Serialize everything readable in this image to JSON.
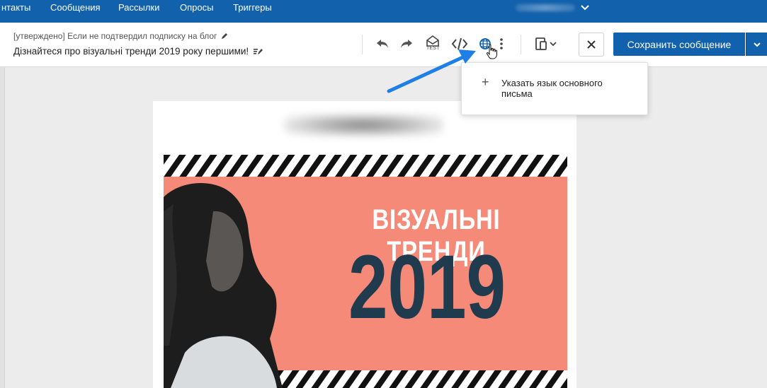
{
  "nav": {
    "items": [
      "нтакты",
      "Сообщения",
      "Рассылки",
      "Опросы",
      "Триггеры"
    ]
  },
  "header": {
    "subject": "[утверждено] Если не подтвердил подписку на блог",
    "preheader": "Дізнайтеся про візуальні тренди 2019 року першими!"
  },
  "toolbar": {
    "test_label": "TEST",
    "save_label": "Сохранить сообщение"
  },
  "dropdown": {
    "item_label": "Указать язык основного письма"
  },
  "banner": {
    "title": "ВІЗУАЛЬНІ ТРЕНДИ",
    "year": "2019"
  },
  "colors": {
    "brand": "#1261ad",
    "banner_bg": "#f58a78",
    "year_text": "#1f3b4d",
    "annotation_arrow": "#1e7fe6"
  },
  "icons": [
    "pencil-icon",
    "edit-text-icon",
    "undo-icon",
    "redo-icon",
    "test-send-icon",
    "code-icon",
    "globe-icon",
    "more-vert-icon",
    "device-preview-icon",
    "chevron-down-icon",
    "close-icon",
    "plus-icon",
    "hand-cursor-icon"
  ]
}
